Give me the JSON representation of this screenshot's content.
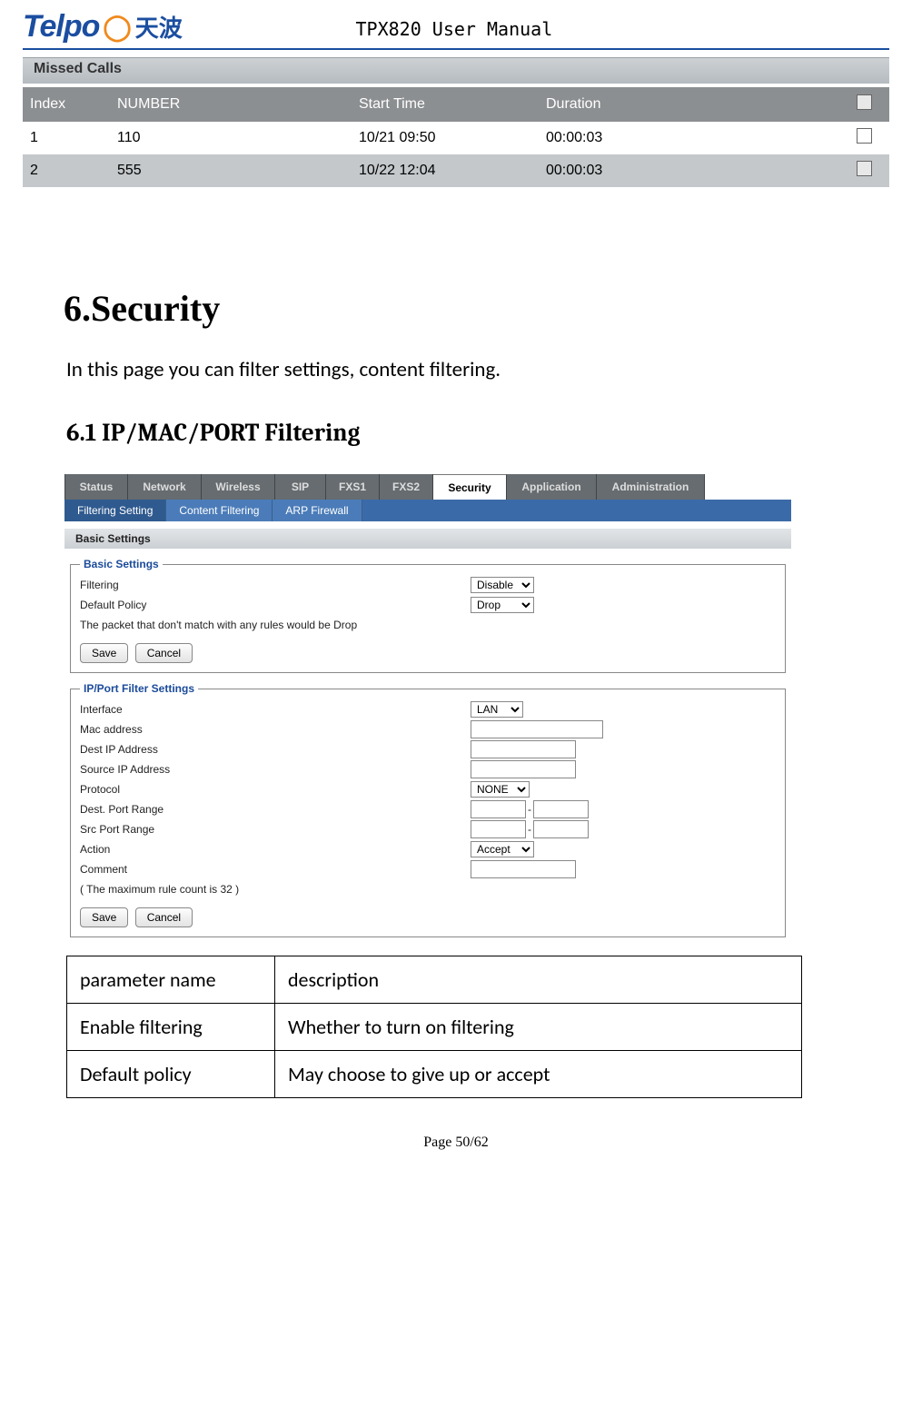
{
  "header": {
    "logo_text": "Telpo",
    "logo_cn": "天波",
    "manual_title": "TPX820 User Manual"
  },
  "missed_calls": {
    "title": "Missed Calls",
    "headers": [
      "Index",
      "NUMBER",
      "Start Time",
      "Duration"
    ],
    "rows": [
      {
        "index": "1",
        "number": "110",
        "start": "10/21 09:50",
        "duration": "00:00:03"
      },
      {
        "index": "2",
        "number": "555",
        "start": "10/22 12:04",
        "duration": "00:00:03"
      }
    ]
  },
  "section": {
    "h1": "6.Security",
    "intro": "In this page you can filter settings, content filtering.",
    "h2": "6.1 IP/MAC/PORT Filtering"
  },
  "ui": {
    "tabs": [
      "Status",
      "Network",
      "Wireless",
      "SIP",
      "FXS1",
      "FXS2",
      "Security",
      "Application",
      "Administration"
    ],
    "active_tab": "Security",
    "subtabs": [
      "Filtering Setting",
      "Content Filtering",
      "ARP Firewall"
    ],
    "active_subtab": "Filtering Setting",
    "panel1": {
      "bar": "Basic Settings",
      "legend": "Basic Settings",
      "filtering_label": "Filtering",
      "filtering_value": "Disable",
      "default_policy_label": "Default Policy",
      "default_policy_value": "Drop",
      "note": "The packet that don't match with any rules would be Drop",
      "save": "Save",
      "cancel": "Cancel"
    },
    "panel2": {
      "legend": "IP/Port Filter Settings",
      "interface_label": "Interface",
      "interface_value": "LAN",
      "mac_label": "Mac address",
      "destip_label": "Dest IP Address",
      "srcip_label": "Source IP Address",
      "proto_label": "Protocol",
      "proto_value": "NONE",
      "destport_label": "Dest. Port Range",
      "srcport_label": "Src Port Range",
      "action_label": "Action",
      "action_value": "Accept",
      "comment_label": "Comment",
      "note": "( The maximum rule count is 32 )",
      "save": "Save",
      "cancel": "Cancel"
    }
  },
  "desc_table": {
    "head": [
      "parameter name",
      "description"
    ],
    "rows": [
      [
        "Enable filtering",
        "Whether to turn on filtering"
      ],
      [
        "Default policy",
        "May choose to give up or accept"
      ]
    ]
  },
  "footer": "Page 50/62"
}
